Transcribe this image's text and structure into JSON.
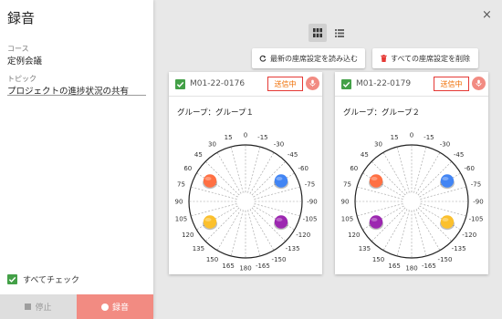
{
  "panel": {
    "title": "録音",
    "course_label": "コース",
    "course_value": "定例会議",
    "topic_label": "トピック",
    "topic_value": "プロジェクトの進捗状況の共有",
    "check_all": "すべてチェック",
    "stop": "停止",
    "record": "録音"
  },
  "toolbar": {
    "close": "×",
    "reload": "最新の座席設定を読み込む",
    "delete_all": "すべての座席設定を削除"
  },
  "colors": {
    "orange": "#ff7043",
    "blue": "#4285f4",
    "yellow": "#fbc02d",
    "purple": "#9c27b0",
    "accent_red": "#f28b82",
    "check_green": "#43a047"
  },
  "dial_labels": [
    "0",
    "-15",
    "-30",
    "-45",
    "-60",
    "-75",
    "-90",
    "-105",
    "-120",
    "-135",
    "-150",
    "-165",
    "180",
    "165",
    "150",
    "135",
    "120",
    "105",
    "90",
    "75",
    "60",
    "45",
    "30",
    "15"
  ],
  "cards": [
    {
      "id": "M01-22-0176",
      "status": "送信中",
      "group": "グループ：グループ１",
      "seats": [
        {
          "name": "seat-orange",
          "angle": 60,
          "color": "#ff7043"
        },
        {
          "name": "seat-blue",
          "angle": -60,
          "color": "#4285f4"
        },
        {
          "name": "seat-yellow",
          "angle": 120,
          "color": "#fbc02d"
        },
        {
          "name": "seat-purple",
          "angle": -120,
          "color": "#9c27b0"
        }
      ]
    },
    {
      "id": "M01-22-0179",
      "status": "送信中",
      "group": "グループ：グループ２",
      "seats": [
        {
          "name": "seat-orange",
          "angle": 60,
          "color": "#ff7043"
        },
        {
          "name": "seat-blue",
          "angle": -60,
          "color": "#4285f4"
        },
        {
          "name": "seat-purple",
          "angle": 120,
          "color": "#9c27b0"
        },
        {
          "name": "seat-yellow",
          "angle": -120,
          "color": "#fbc02d"
        }
      ]
    }
  ]
}
